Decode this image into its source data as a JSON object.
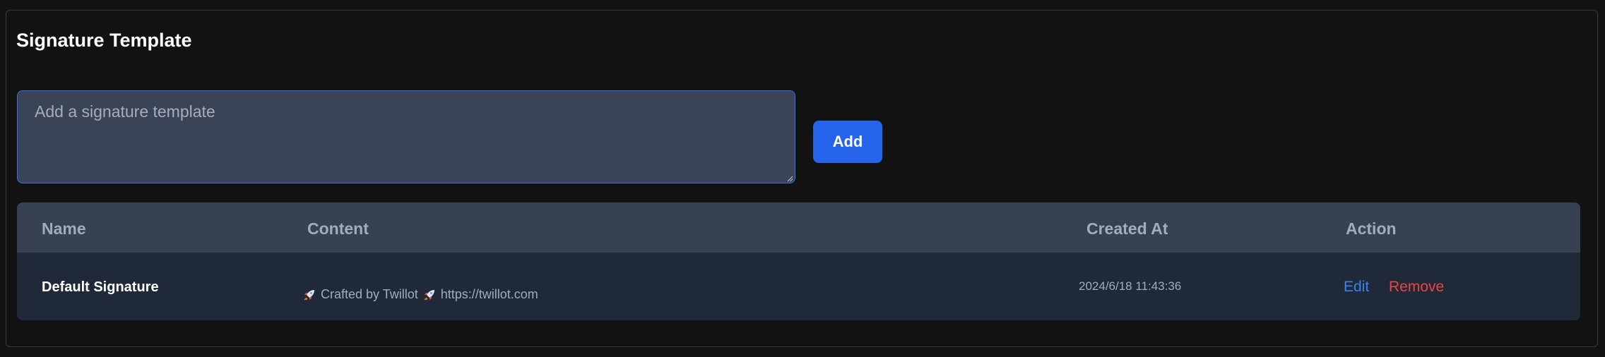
{
  "section": {
    "title": "Signature Template"
  },
  "editor": {
    "placeholder": "Add a signature template",
    "value": "",
    "add_label": "Add"
  },
  "table": {
    "headers": [
      "Name",
      "Content",
      "Created At",
      "Action"
    ],
    "rows": [
      {
        "name": "Default Signature",
        "content_part1": "Crafted by Twillot",
        "content_part2": "https://twillot.com",
        "created_at": "2024/6/18 11:43:36",
        "edit_label": "Edit",
        "remove_label": "Remove"
      }
    ]
  },
  "colors": {
    "background": "#121212",
    "primary_button": "#2563eb",
    "edit_link": "#3b82f6",
    "remove_link": "#ef4444",
    "table_header": "#374151",
    "table_row": "#1f2937"
  },
  "icons": {
    "content_icon": "rocket-icon"
  }
}
